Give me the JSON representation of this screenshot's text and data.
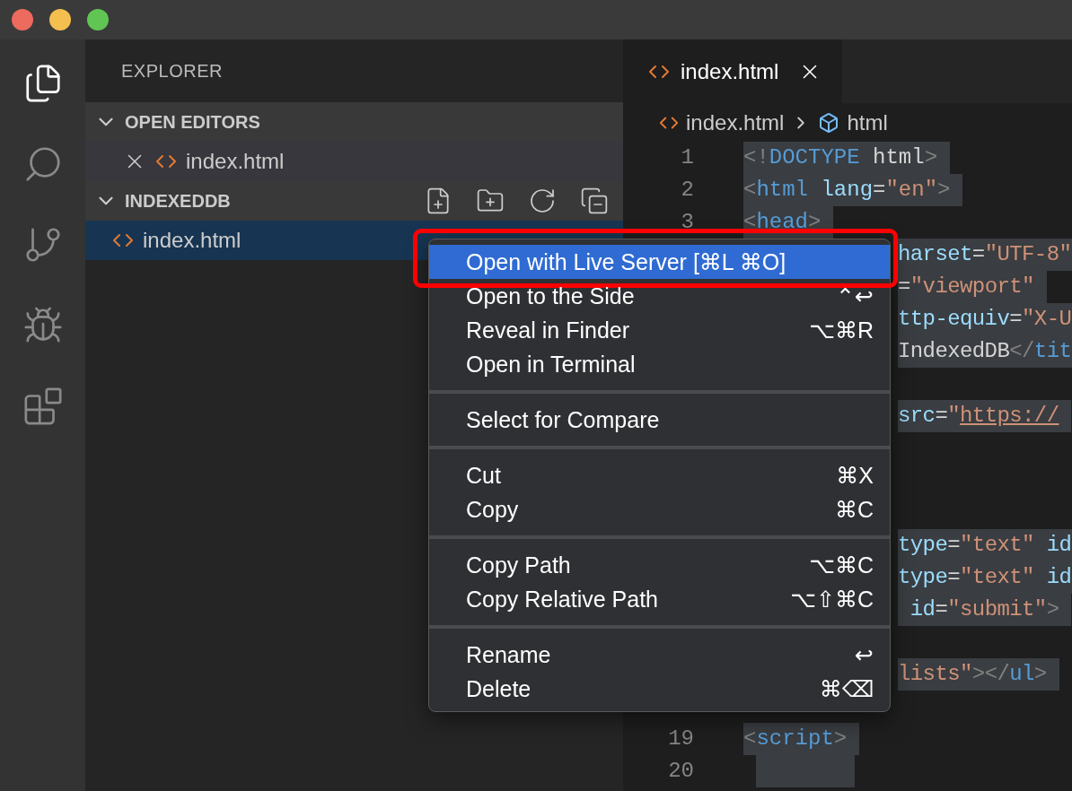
{
  "window": {
    "traffic_lights": [
      {
        "color": "#ed6a5e"
      },
      {
        "color": "#f5bf4f"
      },
      {
        "color": "#61c554"
      }
    ]
  },
  "activity_bar": [
    {
      "kind": "files",
      "selected": true
    },
    {
      "kind": "search",
      "selected": false
    },
    {
      "kind": "source-control",
      "selected": false
    },
    {
      "kind": "debug",
      "selected": false
    },
    {
      "kind": "extensions",
      "selected": false
    }
  ],
  "sidebar": {
    "title": "EXPLORER",
    "sections": [
      {
        "title": "OPEN EDITORS",
        "expanded": true,
        "toolbar": false,
        "items": [
          {
            "label": "index.html",
            "closable": true,
            "selected": false
          }
        ]
      },
      {
        "title": "INDEXEDDB",
        "expanded": true,
        "toolbar": true,
        "items": [
          {
            "label": "index.html",
            "closable": false,
            "selected": true
          }
        ]
      }
    ]
  },
  "tabs": [
    {
      "label": "index.html",
      "selected": true
    }
  ],
  "breadcrumb": [
    {
      "kind": "file",
      "label": "index.html"
    },
    {
      "kind": "symbol",
      "label": "html"
    }
  ],
  "editor": {
    "lines": [
      {
        "kind": "full",
        "number": "1",
        "segments": [
          {
            "kind": "punct",
            "text": "<!"
          },
          {
            "kind": "tag",
            "text": "DOCTYPE"
          },
          {
            "kind": "text",
            "text": " html"
          },
          {
            "kind": "punct",
            "text": ">"
          }
        ]
      },
      {
        "kind": "full",
        "number": "2",
        "segments": [
          {
            "kind": "punct",
            "text": "<"
          },
          {
            "kind": "tag",
            "text": "html"
          },
          {
            "kind": "attr",
            "text": " lang"
          },
          {
            "kind": "text",
            "text": "="
          },
          {
            "kind": "string",
            "text": "\"en\""
          },
          {
            "kind": "punct",
            "text": ">"
          }
        ]
      },
      {
        "kind": "full",
        "number": "3",
        "segments": [
          {
            "kind": "punct",
            "text": "<"
          },
          {
            "kind": "tag",
            "text": "head"
          },
          {
            "kind": "punct",
            "text": ">"
          }
        ]
      },
      {
        "kind": "covered",
        "segments": [
          {
            "kind": "attr",
            "text": "harset"
          },
          {
            "kind": "text",
            "text": "="
          },
          {
            "kind": "string",
            "text": "\"UTF-8\""
          }
        ]
      },
      {
        "kind": "covered",
        "segments": [
          {
            "kind": "text",
            "text": "="
          },
          {
            "kind": "string",
            "text": "\"viewport\""
          }
        ]
      },
      {
        "kind": "covered",
        "segments": [
          {
            "kind": "attr",
            "text": "ttp-equiv"
          },
          {
            "kind": "text",
            "text": "="
          },
          {
            "kind": "string",
            "text": "\"X-U"
          }
        ]
      },
      {
        "kind": "covered",
        "segments": [
          {
            "kind": "text",
            "text": "IndexedDB"
          },
          {
            "kind": "punct",
            "text": "</"
          },
          {
            "kind": "tag",
            "text": "tit"
          }
        ]
      },
      {
        "kind": "covered"
      },
      {
        "kind": "covered",
        "segments": [
          {
            "kind": "attr",
            "text": "src"
          },
          {
            "kind": "text",
            "text": "="
          },
          {
            "kind": "string",
            "text": "\""
          },
          {
            "kind": "link",
            "text": "https://"
          }
        ]
      },
      {
        "kind": "covered"
      },
      {
        "kind": "covered"
      },
      {
        "kind": "covered"
      },
      {
        "kind": "covered",
        "segments": [
          {
            "kind": "attr",
            "text": "type"
          },
          {
            "kind": "text",
            "text": "="
          },
          {
            "kind": "string",
            "text": "\"text\""
          },
          {
            "kind": "attr",
            "text": " id"
          }
        ]
      },
      {
        "kind": "covered",
        "segments": [
          {
            "kind": "attr",
            "text": "type"
          },
          {
            "kind": "text",
            "text": "="
          },
          {
            "kind": "string",
            "text": "\"text\""
          },
          {
            "kind": "attr",
            "text": " id"
          }
        ]
      },
      {
        "kind": "covered",
        "segments": [
          {
            "kind": "attr",
            "text": " id"
          },
          {
            "kind": "text",
            "text": "="
          },
          {
            "kind": "string",
            "text": "\"submit\""
          },
          {
            "kind": "punct",
            "text": ">"
          }
        ]
      },
      {
        "kind": "covered"
      },
      {
        "kind": "covered",
        "segments": [
          {
            "kind": "string",
            "text": "lists\""
          },
          {
            "kind": "punct",
            "text": "></"
          },
          {
            "kind": "tag",
            "text": "ul"
          },
          {
            "kind": "punct",
            "text": ">"
          }
        ]
      },
      {
        "kind": "covered"
      },
      {
        "kind": "full",
        "number": "19",
        "segments": [
          {
            "kind": "punct",
            "text": "<"
          },
          {
            "kind": "tag",
            "text": "script"
          },
          {
            "kind": "punct",
            "text": ">"
          }
        ]
      },
      {
        "kind": "full",
        "number": "20"
      }
    ]
  },
  "context_menu": {
    "groups": [
      [
        {
          "label": "Open with Live Server [⌘L ⌘O]",
          "selected": true,
          "outlined": true
        },
        {
          "label": "Open to the Side",
          "shortcut": "⌃↩",
          "selected": false,
          "outlined": false
        },
        {
          "label": "Reveal in Finder",
          "shortcut": "⌥⌘R",
          "selected": false,
          "outlined": false
        },
        {
          "label": "Open in Terminal",
          "selected": false,
          "outlined": false
        }
      ],
      [
        {
          "label": "Select for Compare",
          "selected": false,
          "outlined": false
        }
      ],
      [
        {
          "label": "Cut",
          "shortcut": "⌘X",
          "selected": false,
          "outlined": false
        },
        {
          "label": "Copy",
          "shortcut": "⌘C",
          "selected": false,
          "outlined": false
        }
      ],
      [
        {
          "label": "Copy Path",
          "shortcut": "⌥⌘C",
          "selected": false,
          "outlined": false
        },
        {
          "label": "Copy Relative Path",
          "shortcut": "⌥⇧⌘C",
          "selected": false,
          "outlined": false
        }
      ],
      [
        {
          "label": "Rename",
          "shortcut": "↩",
          "selected": false,
          "outlined": false
        },
        {
          "label": "Delete",
          "shortcut": "⌘⌫",
          "selected": false,
          "outlined": false
        }
      ]
    ]
  }
}
